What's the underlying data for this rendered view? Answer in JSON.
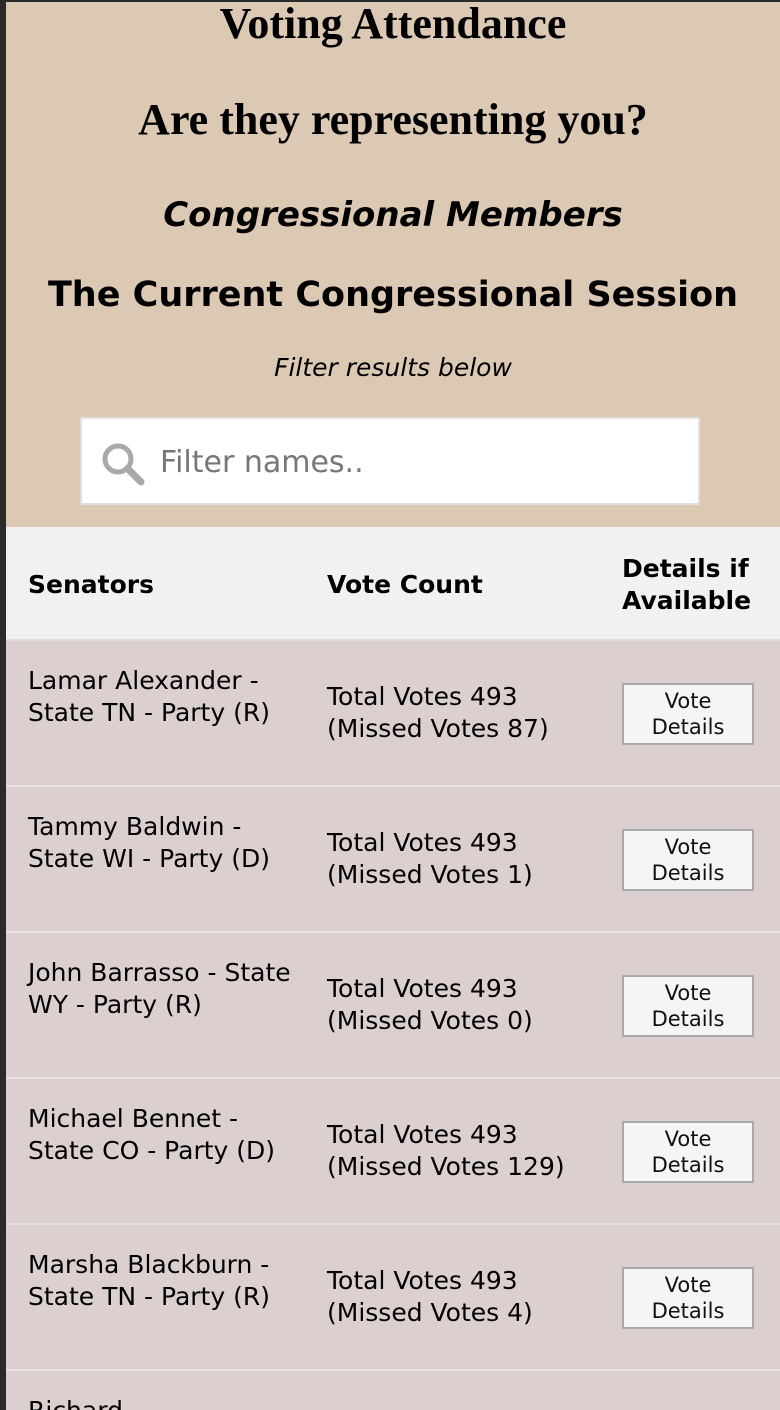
{
  "header": {
    "title": "Voting Attendance",
    "subtitle": "Are they representing you?",
    "section": "Congressional Members",
    "session": "The Current Congressional Session",
    "filter_note": "Filter results below"
  },
  "search": {
    "placeholder": "Filter names..",
    "value": "",
    "icon": "search-icon"
  },
  "table": {
    "columns": [
      "Senators",
      "Vote Count",
      "Details if Available"
    ],
    "button_label": "Vote Details",
    "rows": [
      {
        "name": "Lamar Alexander - State TN - Party (R)",
        "total": "Total Votes 493",
        "missed": "(Missed Votes 87)"
      },
      {
        "name": "Tammy Baldwin - State WI - Party (D)",
        "total": "Total Votes 493",
        "missed": "(Missed Votes 1)"
      },
      {
        "name": "John Barrasso - State WY - Party (R)",
        "total": "Total Votes 493",
        "missed": "(Missed Votes 0)"
      },
      {
        "name": "Michael Bennet - State CO - Party (D)",
        "total": "Total Votes 493",
        "missed": "(Missed Votes 129)"
      },
      {
        "name": "Marsha Blackburn - State TN - Party (R)",
        "total": "Total Votes 493",
        "missed": "(Missed Votes 4)"
      },
      {
        "name": "Richard",
        "total": "",
        "missed": ""
      }
    ]
  },
  "colors": {
    "header_bg": "#dcc9b4",
    "table_header_bg": "#f1f1f1",
    "row_bg": "#dccfcf"
  }
}
